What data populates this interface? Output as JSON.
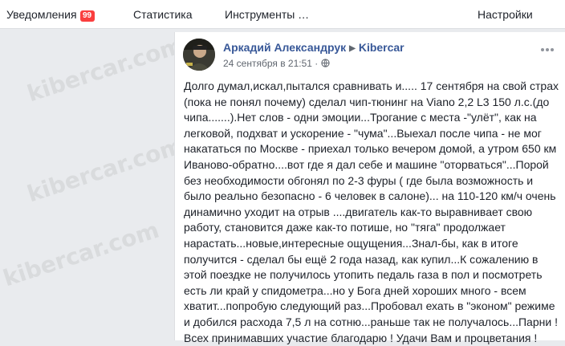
{
  "topbar": {
    "notifications_label": "Уведомления",
    "notifications_count": "99",
    "stats_label": "Статистика",
    "tools_label": "Инструменты …",
    "settings_label": "Настройки"
  },
  "post": {
    "author": "Аркадий Александрук",
    "page": "Kibercar",
    "timestamp": "24 сентября в 21:51 ·",
    "body": "Долго думал,искал,пытался сравнивать и..... 17 сентября на свой страх (пока не понял почему) сделал чип-тюнинг на Viano 2,2 L3 150 л.с.(до чипа.......).Нет слов - одни эмоции...Трогание с места -\"улёт\", как на легковой, подхват и ускорение - \"чума\"...Выехал после чипа - не мог накататься по Москве - приехал только вечером домой, а утром 650 км Иваново-обратно....вот где я дал себе и машине \"оторваться\"...Порой без необходимости обгонял по 2-3 фуры ( где была возможность и было реально безопасно - 6 человек в салоне)... на 110-120 км/ч очень динамично уходит на отрыв ....двигатель как-то выравнивает свою работу, становится даже как-то потише, но \"тяга\" продолжает нарастать...новые,интересные ощущения...Знал-бы, как в итоге получится - сделал бы ещё 2 года назад, как купил...К сожалению в этой поездке не получилось утопить педаль газа в пол и посмотреть есть ли край у спидометра...но у Бога дней хороших много - всем хватит...попробую следующий раз...Пробовал ехать в \"эконом\" режиме и добился расхода 7,5 л на сотню...раньше так не получалось...Парни ! Всех принимавших участие благодарю ! Удачи Вам и процветания !"
  },
  "watermark_text": "kibercar.com",
  "colors": {
    "link": "#385898",
    "text": "#1d2129",
    "badge": "#fa3e3e",
    "background": "#e9ebee"
  }
}
